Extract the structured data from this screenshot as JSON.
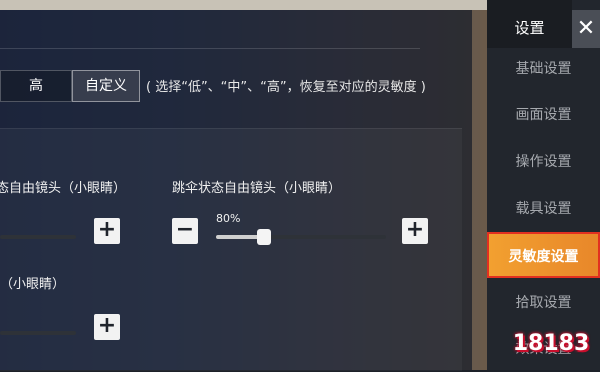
{
  "header": {
    "title": "设置",
    "close_symbol": "✕"
  },
  "nav": {
    "items": [
      {
        "label": "基础设置",
        "active": false
      },
      {
        "label": "画面设置",
        "active": false
      },
      {
        "label": "操作设置",
        "active": false
      },
      {
        "label": "载具设置",
        "active": false
      },
      {
        "label": "灵敏度设置",
        "active": true
      },
      {
        "label": "拾取设置",
        "active": false
      },
      {
        "label": "效果设置",
        "active": false
      }
    ]
  },
  "presets": {
    "high_label": "高",
    "custom_label": "自定义",
    "note": "( 选择“低”、“中”、“高”，恢复至对应的灵敏度 )"
  },
  "sliders": {
    "left_top": {
      "label": "态自由镜头（小眼睛）"
    },
    "right_top": {
      "label": "跳伞状态自由镜头（小眼睛）",
      "value_text": "80%",
      "value": 0.28
    },
    "left_bottom": {
      "label": "（小眼睛）"
    }
  },
  "buttons": {
    "plus": "+",
    "minus": "−"
  },
  "watermark": {
    "text": "18183"
  },
  "colors": {
    "accent": "#ee962c",
    "highlight_border": "#e23020"
  }
}
